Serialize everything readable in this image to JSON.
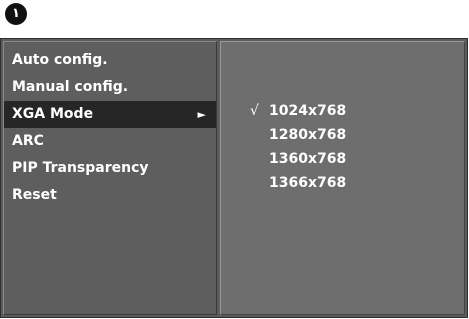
{
  "step": {
    "number": "١"
  },
  "menu": {
    "items": [
      {
        "label": "Auto config."
      },
      {
        "label": "Manual config."
      },
      {
        "label": "XGA Mode",
        "selected": true,
        "arrow_icon": "triangle-right-icon",
        "arrow": "►"
      },
      {
        "label": "ARC"
      },
      {
        "label": "PIP Transparency"
      },
      {
        "label": "Reset"
      }
    ]
  },
  "submenu": {
    "check_icon": "checkmark-icon",
    "check": "√",
    "options": [
      {
        "label": "1024x768",
        "checked": true
      },
      {
        "label": "1280x768",
        "checked": false
      },
      {
        "label": "1360x768",
        "checked": false
      },
      {
        "label": "1366x768",
        "checked": false
      }
    ]
  },
  "colors": {
    "panel": "#5e5e5e",
    "sub_panel": "#6e6e6e",
    "highlight": "#262626",
    "text": "#ffffff"
  }
}
